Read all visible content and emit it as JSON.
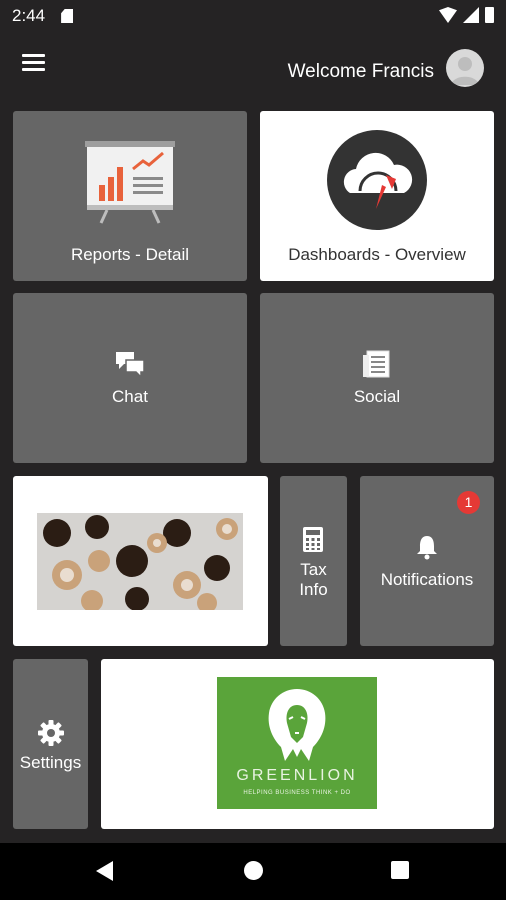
{
  "status_bar": {
    "time": "2:44"
  },
  "header": {
    "welcome_text": "Welcome Francis"
  },
  "tiles": {
    "reports": {
      "label": "Reports - Detail"
    },
    "dashboards": {
      "label": "Dashboards - Overview"
    },
    "chat": {
      "label": "Chat"
    },
    "social": {
      "label": "Social"
    },
    "tax": {
      "label_line1": "Tax",
      "label_line2": "Info"
    },
    "notifications": {
      "label": "Notifications",
      "badge_count": "1"
    },
    "settings": {
      "label": "Settings"
    }
  },
  "promo": {
    "brand_name": "GREENLION",
    "tagline": "HELPING BUSINESS THINK + DO"
  },
  "colors": {
    "background": "#252324",
    "tile_gray": "#666666",
    "tile_white": "#ffffff",
    "badge_red": "#e53935",
    "brand_green": "#5aa43a"
  },
  "icons": {
    "reports": "presentation-chart-icon",
    "dashboards": "cloud-gauge-icon",
    "chat": "chat-bubbles-icon",
    "social": "newspaper-icon",
    "tax": "calculator-icon",
    "notifications": "bell-icon",
    "settings": "gear-icon"
  }
}
